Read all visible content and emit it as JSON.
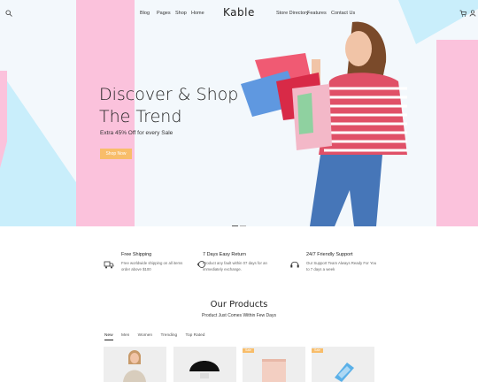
{
  "header": {
    "logo": "Kable",
    "nav_left": [
      "Blog",
      "Pages",
      "Shop",
      "Home"
    ],
    "nav_right": [
      "Store Directory",
      "Features",
      "Contact Us"
    ]
  },
  "hero": {
    "title_line1": "Discover & Shop",
    "title_line2": "The Trend",
    "subtitle": "Extra 45% Off for every Sale",
    "button": "Shop Now"
  },
  "features": [
    {
      "title": "Free Shipping",
      "desc": "Free worldwide shipping on all items order above $100",
      "icon": "truck-icon"
    },
    {
      "title": "7 Days Easy Return",
      "desc": "Product any fault within 07 days for an immediately exchange.",
      "icon": "return-icon"
    },
    {
      "title": "24/7 Friendly Support",
      "desc": "Our Support Team Always Ready For You to 7 days a week",
      "icon": "headset-icon"
    }
  ],
  "products": {
    "title": "Our Products",
    "subtitle": "Product Just Comes Within Few Days",
    "tabs": [
      "New",
      "Men",
      "Women",
      "Trending",
      "Top Rated"
    ],
    "badges": [
      "Sale",
      "Sale"
    ]
  },
  "colors": {
    "pink": "#fbc2dc",
    "blue": "#c9eefb",
    "accent": "#f8bd6a"
  }
}
